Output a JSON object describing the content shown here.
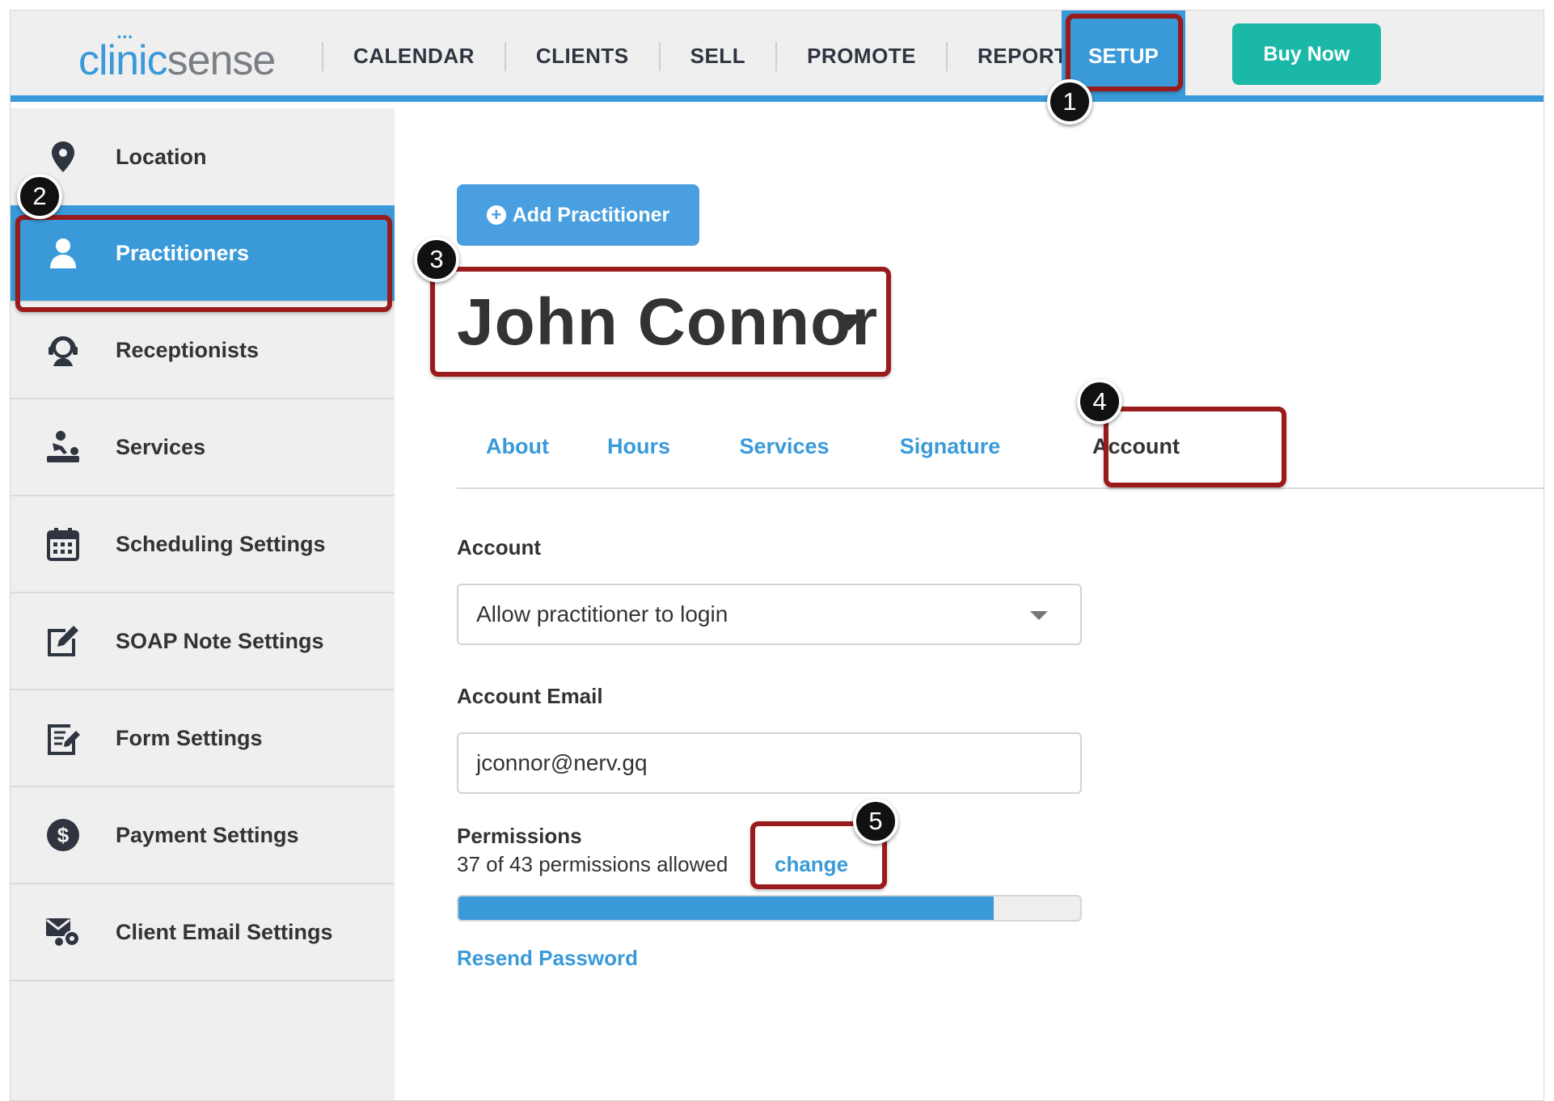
{
  "logo": {
    "part1": "clinic",
    "part2": "sense",
    "dots": "•••"
  },
  "nav": {
    "items": [
      "CALENDAR",
      "CLIENTS",
      "SELL",
      "PROMOTE",
      "REPORTS"
    ],
    "active": "SETUP",
    "buy_now": "Buy Now"
  },
  "sidebar": {
    "items": [
      {
        "label": "Location",
        "icon": "map-pin-icon"
      },
      {
        "label": "Practitioners",
        "icon": "user-icon",
        "active": true
      },
      {
        "label": "Receptionists",
        "icon": "headset-user-icon"
      },
      {
        "label": "Services",
        "icon": "massage-icon"
      },
      {
        "label": "Scheduling Settings",
        "icon": "calendar-icon"
      },
      {
        "label": "SOAP Note Settings",
        "icon": "edit-icon"
      },
      {
        "label": "Form Settings",
        "icon": "form-edit-icon"
      },
      {
        "label": "Payment Settings",
        "icon": "dollar-circle-icon"
      },
      {
        "label": "Client Email Settings",
        "icon": "email-settings-icon"
      }
    ]
  },
  "main": {
    "add_button": "Add Practitioner",
    "practitioner_name": "John Connor",
    "tabs": [
      "About",
      "Hours",
      "Services",
      "Signature",
      "Account"
    ],
    "active_tab": "Account",
    "account_label": "Account",
    "account_value": "Allow practitioner to login",
    "email_label": "Account Email",
    "email_value": "jconnor@nerv.gq",
    "permissions_label": "Permissions",
    "permissions_text": "37 of 43 permissions allowed",
    "permissions_allowed": 37,
    "permissions_total": 43,
    "change_link": "change",
    "resend_link": "Resend Password"
  },
  "annotations": [
    "1",
    "2",
    "3",
    "4",
    "5"
  ],
  "colors": {
    "accent": "#3a9ad9",
    "buy": "#1cb8a7",
    "highlight": "#9a1b1b"
  }
}
